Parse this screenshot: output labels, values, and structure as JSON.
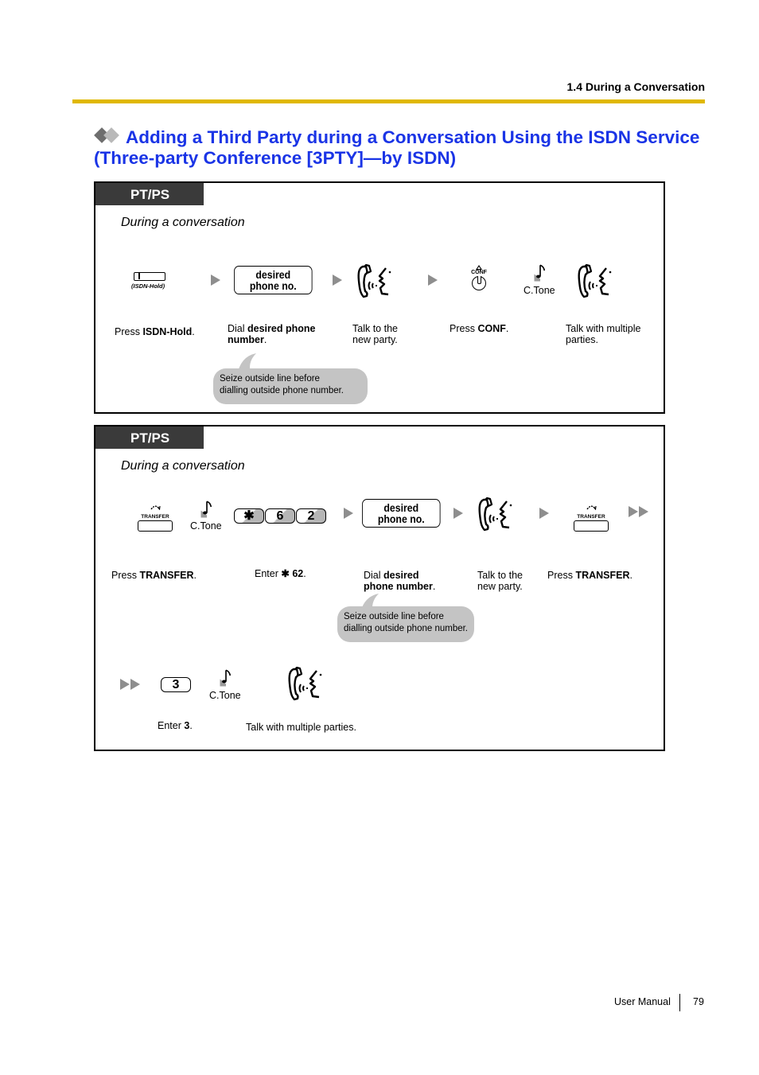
{
  "header": {
    "section": "1.4 During a Conversation",
    "rule_color": "#e0b800"
  },
  "title": {
    "line1": "Adding a Third Party during a Conversation Using the ISDN Service",
    "line2": "(Three-party Conference [3PTY]—by ISDN)",
    "color": "#1a34e6",
    "icon": "double-diamond-icon"
  },
  "panel1": {
    "tag": "PT/PS",
    "context": "During a conversation",
    "steps": [
      {
        "icon": "isdn-hold-button-icon",
        "icon_label": "(ISDN-Hold)",
        "text_pre": "Press ",
        "text_bold": "ISDN-Hold",
        "text_post": "."
      },
      {
        "icon": "phone-number-box",
        "box_line1": "desired",
        "box_line2": "phone no.",
        "text_pre": "Dial ",
        "text_bold": "desired phone number",
        "text_post": "."
      },
      {
        "icon": "talk-icon",
        "text_line1": "Talk to the",
        "text_line2": "new party."
      },
      {
        "icon": "conf-button-icon",
        "icon_label": "CONF",
        "text_pre": "Press ",
        "text_bold": "CONF",
        "text_post": "."
      },
      {
        "icon": "confirmation-tone-icon",
        "icon_label": "C.Tone"
      },
      {
        "icon": "talk-icon",
        "text_line1": "Talk with multiple",
        "text_line2": "parties."
      }
    ],
    "note": {
      "line1": "Seize outside line before",
      "line2": "dialling outside phone number."
    }
  },
  "panel2": {
    "tag": "PT/PS",
    "context": "During a conversation",
    "steps": [
      {
        "icon": "transfer-button-icon",
        "icon_label": "TRANSFER",
        "text_pre": "Press ",
        "text_bold": "TRANSFER",
        "text_post": "."
      },
      {
        "icon": "confirmation-tone-icon",
        "icon_label": "C.Tone"
      },
      {
        "icon": "keypad-keys",
        "keys": [
          "✱",
          "6",
          "2"
        ],
        "text_pre": "Enter ",
        "text_star": "✱",
        "text_bold": " 62",
        "text_post": "."
      },
      {
        "icon": "phone-number-box",
        "box_line1": "desired",
        "box_line2": "phone no.",
        "text_pre": "Dial ",
        "text_bold1": "desired",
        "text_bold2": "phone number",
        "text_post": "."
      },
      {
        "icon": "talk-icon",
        "text_line1": "Talk to the",
        "text_line2": "new party."
      },
      {
        "icon": "transfer-button-icon",
        "icon_label": "TRANSFER",
        "text_pre": "Press ",
        "text_bold": "TRANSFER",
        "text_post": "."
      }
    ],
    "note": {
      "line1": "Seize outside line before",
      "line2": "dialling outside phone number."
    },
    "steps_row2": [
      {
        "icon": "keypad-key",
        "key": "3",
        "text_pre": "Enter ",
        "text_bold": "3",
        "text_post": "."
      },
      {
        "icon": "confirmation-tone-icon",
        "icon_label": "C.Tone"
      },
      {
        "icon": "talk-icon",
        "text": "Talk with multiple parties."
      }
    ]
  },
  "footer": {
    "label": "User Manual",
    "page": "79"
  }
}
